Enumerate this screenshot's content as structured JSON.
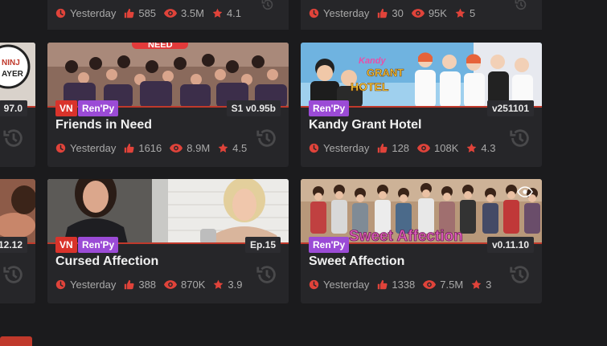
{
  "top_row": [
    {
      "date": "Yesterday",
      "likes": "585",
      "views": "3.5M",
      "rating": "4.1"
    },
    {
      "date": "Yesterday",
      "likes": "30",
      "views": "95K",
      "rating": "5"
    }
  ],
  "left_partial": {
    "ver_a": "97.0",
    "ver_b": "12.12"
  },
  "cards": [
    {
      "title": "Friends in Need",
      "tags": [
        "VN",
        "Ren'Py"
      ],
      "version": "S1 v0.95b",
      "date": "Yesterday",
      "likes": "1616",
      "views": "8.9M",
      "rating": "4.5"
    },
    {
      "title": "Kandy Grant Hotel",
      "tags": [
        "Ren'Py"
      ],
      "version": "v251101",
      "date": "Yesterday",
      "likes": "128",
      "views": "108K",
      "rating": "4.3"
    },
    {
      "title": "Cursed Affection",
      "tags": [
        "VN",
        "Ren'Py"
      ],
      "version": "Ep.15",
      "date": "Yesterday",
      "likes": "388",
      "views": "870K",
      "rating": "3.9"
    },
    {
      "title": "Sweet Affection",
      "tags": [
        "Ren'Py"
      ],
      "version": "v0.11.10",
      "date": "Yesterday",
      "likes": "1338",
      "views": "7.5M",
      "rating": "3"
    }
  ],
  "logo_texts": {
    "kandy": "Kandy GRANT HOTEL",
    "sweet": "Sweet Affection",
    "need": "NEED"
  },
  "colors": {
    "accent": "#c0392b",
    "vn": "#d9332b",
    "renpy": "#9b4bd6",
    "background": "#1b1b1d",
    "card": "#262629"
  }
}
